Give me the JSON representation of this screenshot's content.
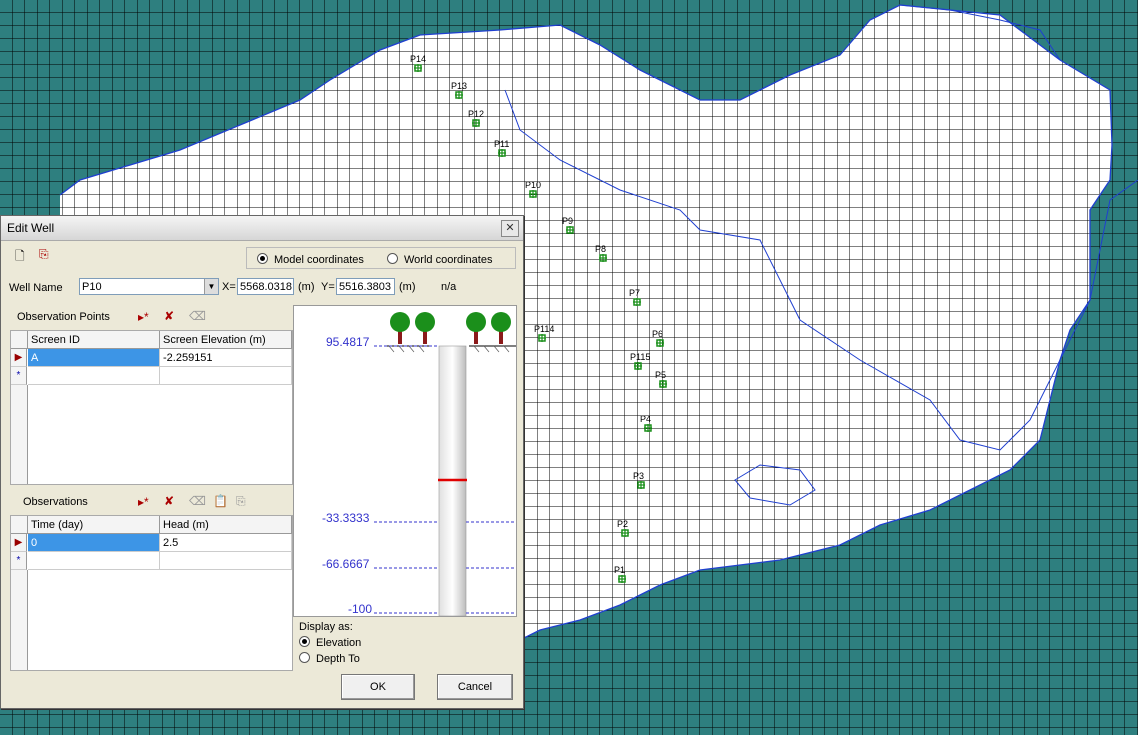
{
  "dialog": {
    "title": "Edit Well",
    "coord_model_label": "Model coordinates",
    "coord_world_label": "World coordinates",
    "well_name_label": "Well Name",
    "well_name_value": "P10",
    "x_label": "X=",
    "x_value": "5568.0318",
    "x_unit": "(m)",
    "y_label": "Y=",
    "y_value": "5516.3803",
    "y_unit": "(m)",
    "na_text": "n/a",
    "obs_points": {
      "title": "Observation Points",
      "col1": "Screen ID",
      "col2": "Screen Elevation (m)",
      "rows": [
        {
          "id": "A",
          "elev": "-2.259151"
        }
      ]
    },
    "observations": {
      "title": "Observations",
      "col1": "Time (day)",
      "col2": "Head (m)",
      "rows": [
        {
          "time": "0",
          "head": "2.5"
        }
      ]
    },
    "profile": {
      "elev_top": "95.4817",
      "elev_1": "-33.3333",
      "elev_2": "-66.6667",
      "elev_3": "-100"
    },
    "display_as_label": "Display as:",
    "display_elev": "Elevation",
    "display_depth": "Depth To",
    "ok_label": "OK",
    "cancel_label": "Cancel"
  },
  "map": {
    "wells": [
      "P14",
      "P13",
      "P12",
      "P11",
      "P10",
      "P9",
      "P8",
      "P7",
      "P114",
      "P6",
      "P115",
      "P5",
      "P4",
      "P3",
      "P2",
      "P1"
    ]
  }
}
